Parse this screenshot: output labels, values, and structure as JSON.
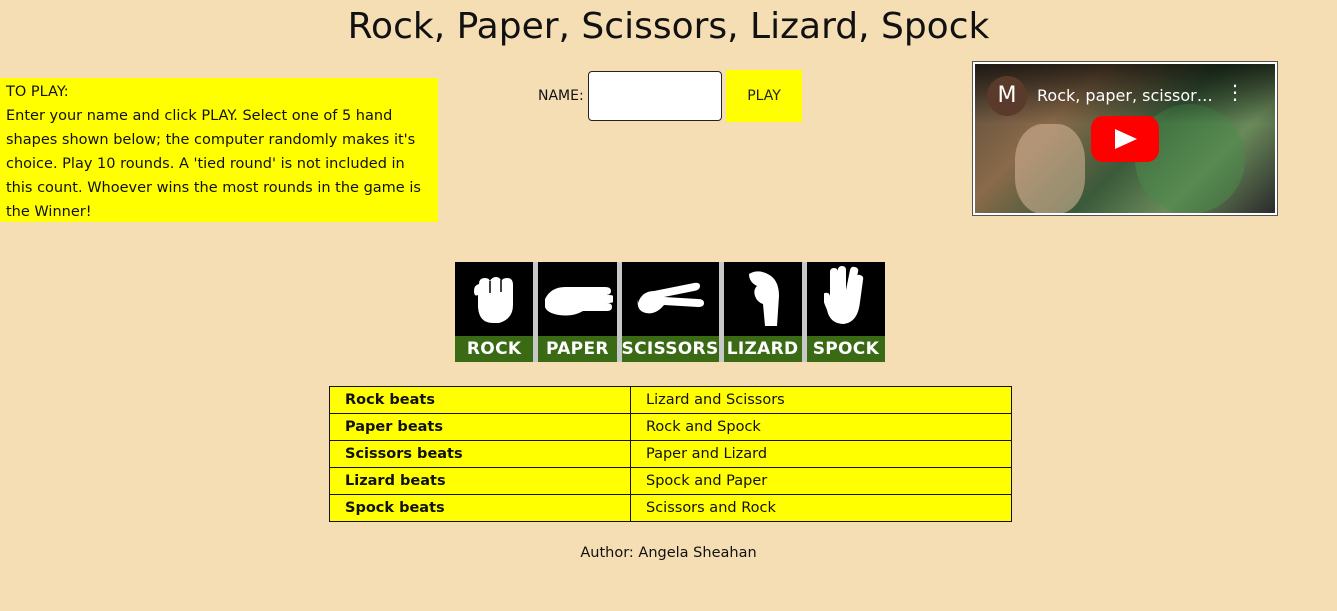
{
  "page": {
    "title": "Rock, Paper, Scissors, Lizard, Spock",
    "background_color": "#f5deb3",
    "accent_color": "#ffff00"
  },
  "instructions": {
    "heading": "TO PLAY:",
    "body": "Enter your name and click PLAY. Select one of 5 hand shapes shown below; the computer randomly makes it's choice. Play 10 rounds. A 'tied round' is not included in this count. Whoever wins the most rounds in the game is the Winner!"
  },
  "player": {
    "name_label": "NAME:",
    "name_value": "",
    "play_label": "PLAY"
  },
  "video": {
    "channel_initial": "M",
    "title": "Rock, paper, scissor…",
    "menu_icon": "more-vert-icon",
    "play_icon": "youtube-play-icon"
  },
  "choices": [
    {
      "label": "ROCK",
      "icon": "fist-icon"
    },
    {
      "label": "PAPER",
      "icon": "open-hand-icon"
    },
    {
      "label": "SCISSORS",
      "icon": "scissors-hand-icon"
    },
    {
      "label": "LIZARD",
      "icon": "lizard-hand-icon"
    },
    {
      "label": "SPOCK",
      "icon": "vulcan-salute-icon"
    }
  ],
  "rules_table": [
    {
      "winner": "Rock beats",
      "beats": "Lizard and Scissors"
    },
    {
      "winner": "Paper beats",
      "beats": "Rock and Spock"
    },
    {
      "winner": "Scissors beats",
      "beats": "Paper and Lizard"
    },
    {
      "winner": "Lizard beats",
      "beats": "Spock and Paper"
    },
    {
      "winner": "Spock beats",
      "beats": "Scissors and Rock"
    }
  ],
  "footer": {
    "author": "Author: Angela Sheahan"
  }
}
